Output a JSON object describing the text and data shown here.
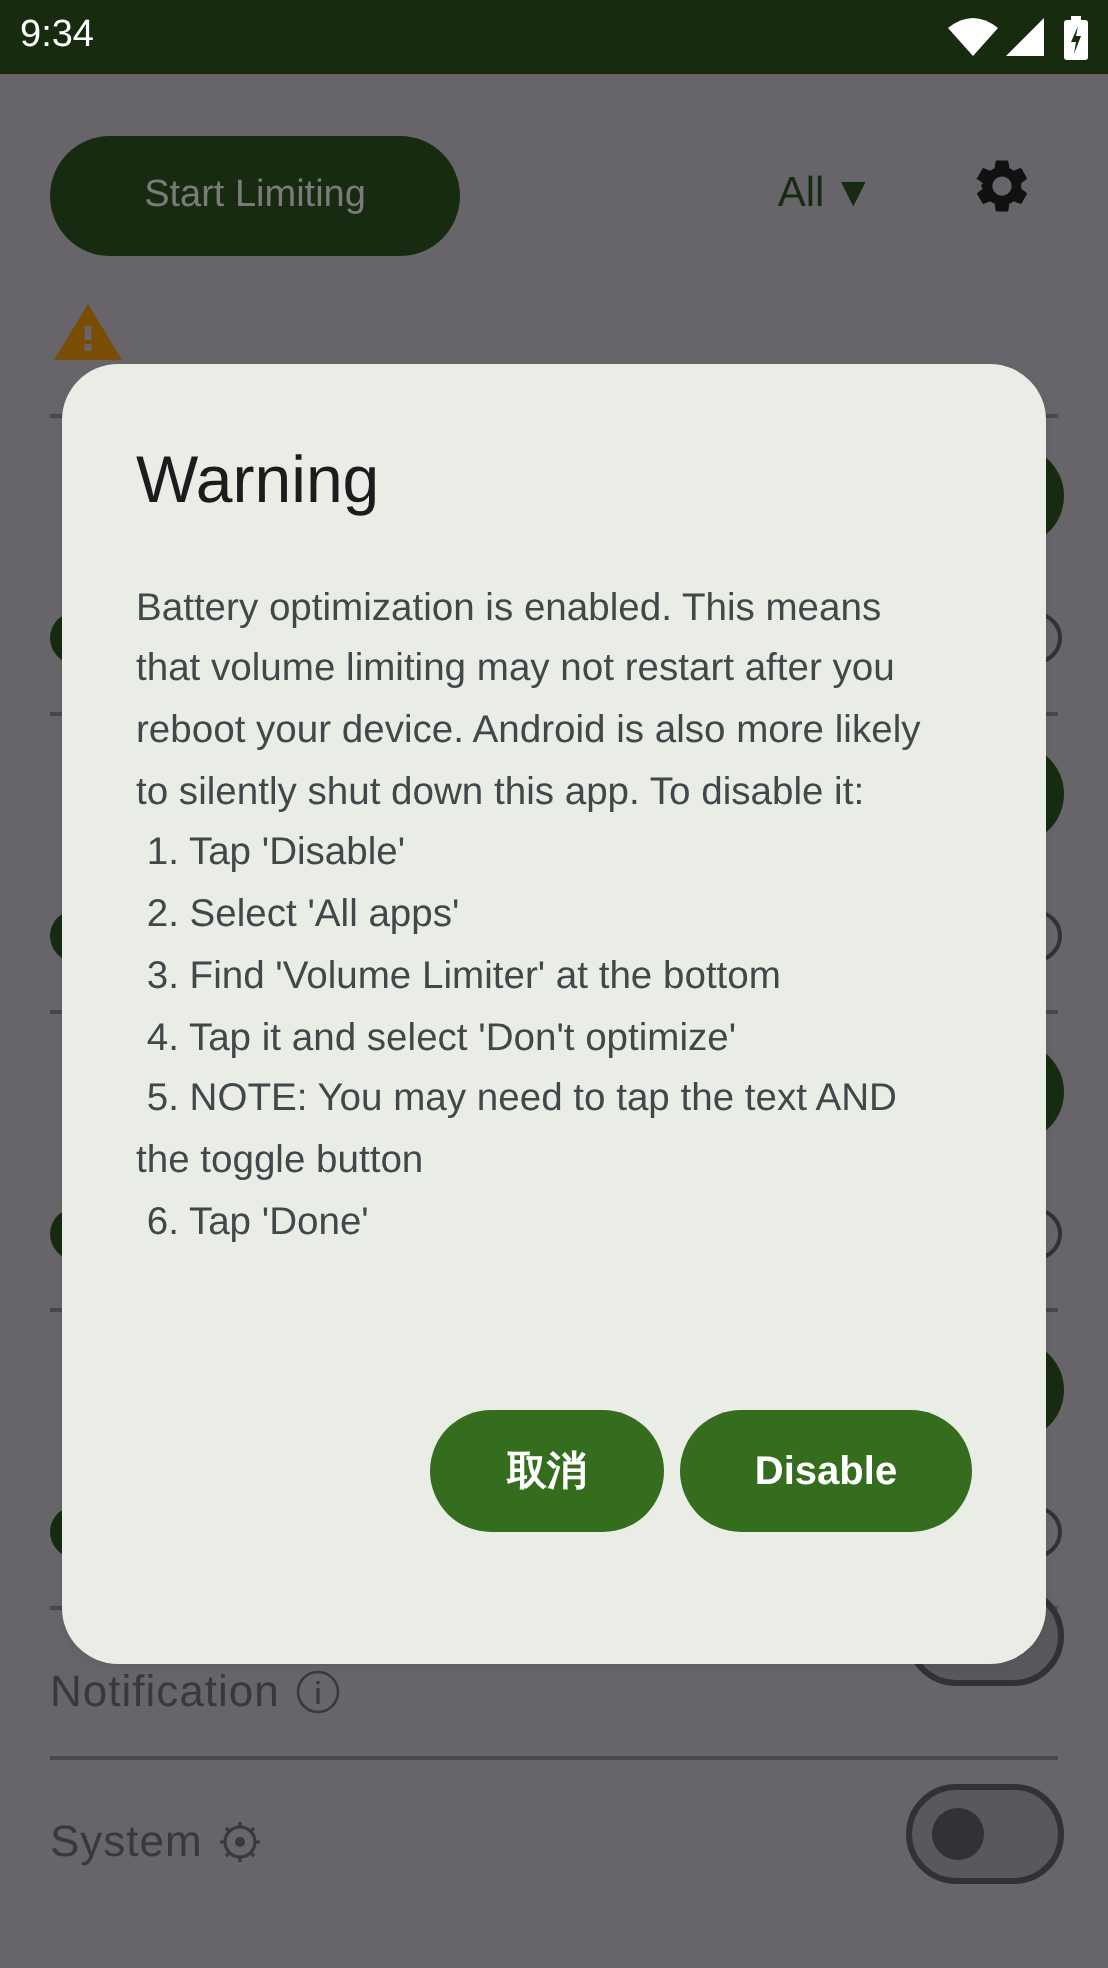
{
  "status_bar": {
    "time": "9:34"
  },
  "toolbar": {
    "start_button": "Start Limiting",
    "filter": "All",
    "filter_caret": "▼"
  },
  "streams": [
    {
      "on": true,
      "level": 0
    },
    {
      "on": true,
      "level": 0
    },
    {
      "on": true,
      "level": 0
    },
    {
      "on": true,
      "level": 0
    }
  ],
  "settings": [
    {
      "label": "Notification",
      "kind": "info",
      "on": false
    },
    {
      "label": "System",
      "kind": "gear",
      "on": false
    }
  ],
  "dialog": {
    "title": "Warning",
    "body": "Battery optimization is enabled. This means that volume limiting may not restart after you reboot your device. Android is also more likely to silently shut down this app. To disable it:\n 1. Tap 'Disable'\n 2. Select 'All apps'\n 3. Find 'Volume Limiter' at the bottom\n 4. Tap it and select 'Don't optimize'\n 5. NOTE: You may need to tap the text AND the toggle button\n 6. Tap 'Done'",
    "buttons": [
      {
        "label": "取消",
        "kind": "cancel"
      },
      {
        "label": "Disable",
        "kind": "confirm"
      }
    ]
  }
}
